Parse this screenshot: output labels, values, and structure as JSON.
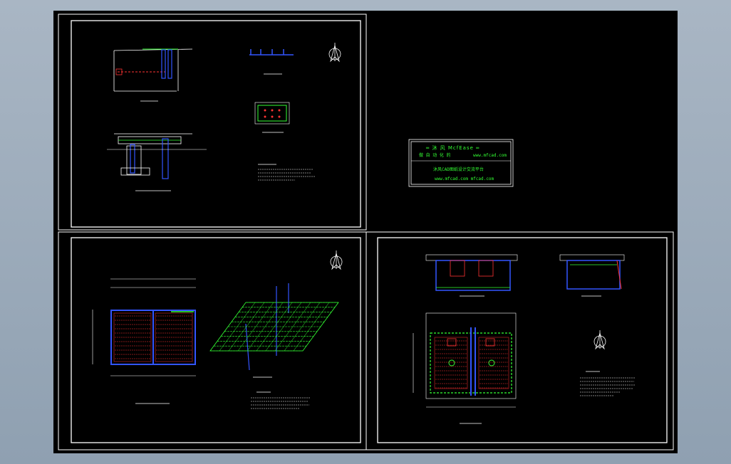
{
  "title_block": {
    "brand": "═ 沐 风 McfEase ═",
    "line2_left": "做 自 动 化 的",
    "line2_right": "www.mfcad.com",
    "line3": "沐风CAD图纸设计交流平台",
    "line4": "www.mfcad.com  mfcad.com"
  },
  "colors": {
    "background": "#000000",
    "frame": "#ffffff",
    "pipe": "#3355ff",
    "hatch_red": "#ff3333",
    "hatch_green": "#33ff33",
    "titlebox_green": "#33ff33",
    "outer_bg": "#a9b6c4"
  },
  "icons": {
    "north_arrow": "north-arrow-icon"
  }
}
